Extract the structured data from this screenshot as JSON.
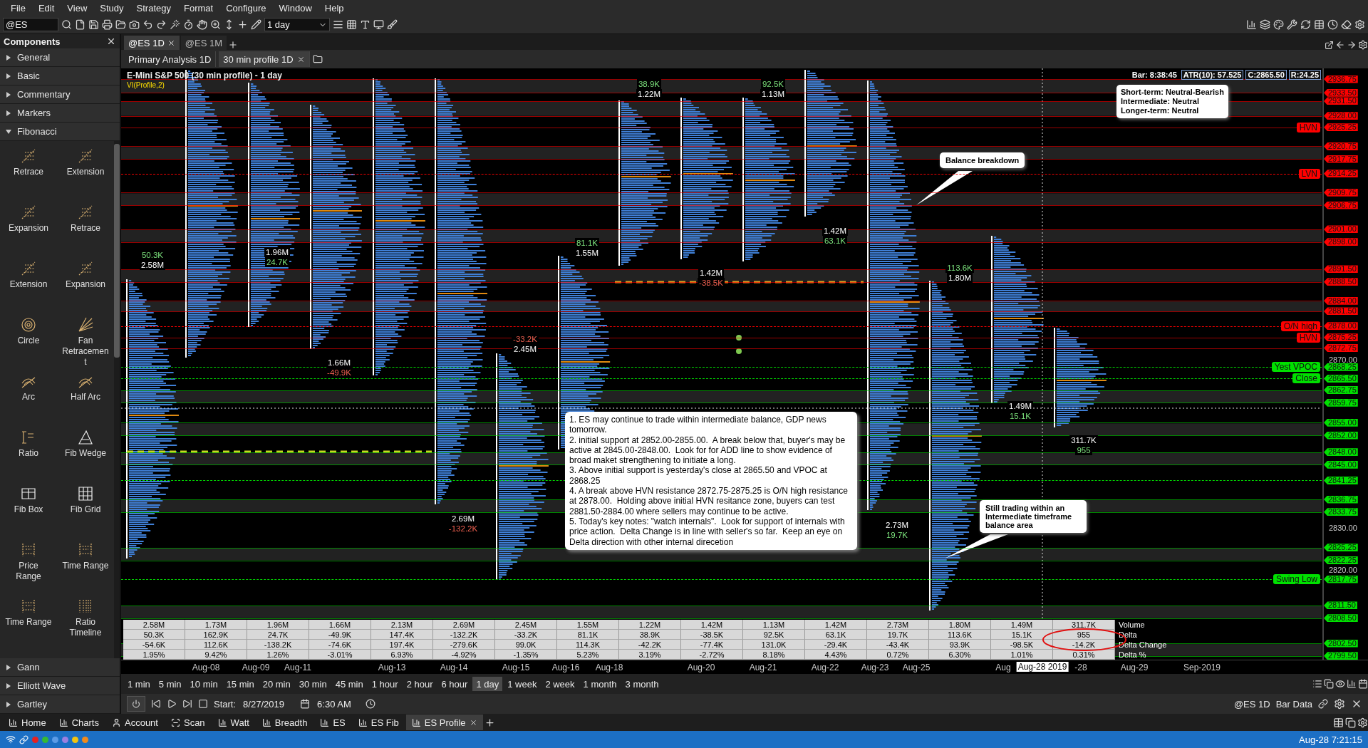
{
  "menu": [
    "File",
    "Edit",
    "View",
    "Study",
    "Strategy",
    "Format",
    "Configure",
    "Window",
    "Help"
  ],
  "toolbar": {
    "symbol": "@ES",
    "interval": "1 day"
  },
  "components": {
    "title": "Components",
    "groups": [
      {
        "label": "General",
        "expanded": false
      },
      {
        "label": "Basic",
        "expanded": false
      },
      {
        "label": "Commentary",
        "expanded": false
      },
      {
        "label": "Markers",
        "expanded": false
      },
      {
        "label": "Fibonacci",
        "expanded": true,
        "tools": [
          "Retrace",
          "Extension",
          "Expansion",
          "Retrace",
          "Extension",
          "Expansion",
          "Circle",
          "Fan Retracement",
          "Arc",
          "Half Arc",
          "Ratio",
          "Fib Wedge",
          "Fib Box",
          "Fib Grid",
          "Price Range",
          "Time Range",
          "Time Range",
          "Ratio Timeline"
        ]
      },
      {
        "label": "Gann",
        "expanded": false
      },
      {
        "label": "Elliott Wave",
        "expanded": false
      },
      {
        "label": "Gartley",
        "expanded": false
      }
    ]
  },
  "chart_tabs": [
    {
      "label": "@ES 1D",
      "selected": true
    },
    {
      "label": "@ES 1M",
      "selected": false
    }
  ],
  "sub_tabs": [
    {
      "label": "Primary Analysis 1D",
      "selected": false
    },
    {
      "label": "30 min profile 1D",
      "selected": true
    }
  ],
  "chart": {
    "title": "E-Mini S&P 500 (30 min profile) - 1 day",
    "study": "VI(Profile,2)",
    "bar_info": "Bar: 8:38:45",
    "info_boxes": [
      "ATR(10): 57.525",
      "C:2865.50",
      "R:24.25"
    ],
    "price_levels": [
      {
        "price": "2936.75",
        "color": "#ff0000",
        "dashed": false
      },
      {
        "price": "2933.50",
        "color": "#ff0000",
        "dashed": false
      },
      {
        "price": "2931.50",
        "color": "#ff0000",
        "dashed": false
      },
      {
        "price": "2928.00",
        "color": "#ff0000",
        "dashed": false
      },
      {
        "price": "2925.25",
        "color": "#ff0000",
        "dashed": false,
        "label": "HVN"
      },
      {
        "price": "2920.75",
        "color": "#ff0000",
        "dashed": false
      },
      {
        "price": "2917.75",
        "color": "#ff0000",
        "dashed": false
      },
      {
        "price": "2914.25",
        "color": "#ff0000",
        "dashed": true,
        "label": "LVN"
      },
      {
        "price": "2909.75",
        "color": "#ff0000",
        "dashed": false
      },
      {
        "price": "2906.75",
        "color": "#ff0000",
        "dashed": false
      },
      {
        "price": "2901.00",
        "color": "#ff0000",
        "dashed": false
      },
      {
        "price": "2898.00",
        "color": "#ff0000",
        "dashed": false
      },
      {
        "price": "2891.50",
        "color": "#ff0000",
        "dashed": false
      },
      {
        "price": "2888.50",
        "color": "#ff0000",
        "dashed": false
      },
      {
        "price": "2884.00",
        "color": "#ff0000",
        "dashed": false
      },
      {
        "price": "2881.50",
        "color": "#ff0000",
        "dashed": false
      },
      {
        "price": "2878.00",
        "color": "#ff0000",
        "dashed": true,
        "label": "O/N high"
      },
      {
        "price": "2875.25",
        "color": "#ff0000",
        "dashed": false,
        "label": "HVN"
      },
      {
        "price": "2872.75",
        "color": "#ff0000",
        "dashed": false
      },
      {
        "price": "2868.25",
        "color": "#00e000",
        "dashed": true,
        "label": "Yest VPOC"
      },
      {
        "price": "2865.50",
        "color": "#00e000",
        "dashed": true,
        "label": "Close"
      },
      {
        "price": "2862.75",
        "color": "#00e000",
        "dashed": false
      },
      {
        "price": "2859.75",
        "color": "#00e000",
        "dashed": false
      },
      {
        "price": "2855.00",
        "color": "#00e000",
        "dashed": false
      },
      {
        "price": "2852.00",
        "color": "#00e000",
        "dashed": false
      },
      {
        "price": "2848.00",
        "color": "#00e000",
        "dashed": false
      },
      {
        "price": "2845.00",
        "color": "#00e000",
        "dashed": false
      },
      {
        "price": "2841.25",
        "color": "#00e000",
        "dashed": true
      },
      {
        "price": "2836.75",
        "color": "#00e000",
        "dashed": false
      },
      {
        "price": "2833.75",
        "color": "#00e000",
        "dashed": false
      },
      {
        "price": "2825.25",
        "color": "#00e000",
        "dashed": false
      },
      {
        "price": "2822.25",
        "color": "#00e000",
        "dashed": false
      },
      {
        "price": "2817.75",
        "color": "#00e000",
        "dashed": true,
        "label": "Swing Low"
      },
      {
        "price": "2811.50",
        "color": "#00e000",
        "dashed": false
      },
      {
        "price": "2808.50",
        "color": "#00e000",
        "dashed": false
      },
      {
        "price": "2802.50",
        "color": "#00e000",
        "dashed": false
      },
      {
        "price": "2799.50",
        "color": "#00e000",
        "dashed": false
      }
    ],
    "axis_labels": [
      "2870.00",
      "2830.00",
      "2820.00"
    ],
    "session_labels": [
      {
        "lines": [
          {
            "text": "50.3K",
            "color": "#7be07b"
          },
          {
            "text": "2.58M",
            "color": "#ffffff"
          }
        ]
      },
      {
        "lines": [
          {
            "text": "1.96M",
            "color": "#ffffff"
          },
          {
            "text": "24.7K",
            "color": "#7be07b"
          }
        ]
      },
      {
        "lines": [
          {
            "text": "1.66M",
            "color": "#ffffff"
          },
          {
            "text": "-49.9K",
            "color": "#f06050"
          }
        ]
      },
      {
        "lines": [
          {
            "text": "-33.2K",
            "color": "#f06050"
          },
          {
            "text": "2.45M",
            "color": "#ffffff"
          }
        ]
      },
      {
        "lines": [
          {
            "text": "2.69M",
            "color": "#ffffff"
          },
          {
            "text": "-132.2K",
            "color": "#f06050"
          }
        ]
      },
      {
        "lines": [
          {
            "text": "81.1K",
            "color": "#7be07b"
          },
          {
            "text": "1.55M",
            "color": "#ffffff"
          }
        ]
      },
      {
        "lines": [
          {
            "text": "38.9K",
            "color": "#7be07b"
          },
          {
            "text": "1.22M",
            "color": "#ffffff"
          }
        ]
      },
      {
        "lines": [
          {
            "text": "1.42M",
            "color": "#ffffff"
          },
          {
            "text": "-38.5K",
            "color": "#f06050"
          }
        ]
      },
      {
        "lines": [
          {
            "text": "92.5K",
            "color": "#7be07b"
          },
          {
            "text": "1.13M",
            "color": "#ffffff"
          }
        ]
      },
      {
        "lines": [
          {
            "text": "1.42M",
            "color": "#ffffff"
          },
          {
            "text": "63.1K",
            "color": "#7be07b"
          }
        ]
      },
      {
        "lines": [
          {
            "text": "2.73M",
            "color": "#ffffff"
          },
          {
            "text": "19.7K",
            "color": "#7be07b"
          }
        ]
      },
      {
        "lines": [
          {
            "text": "113.6K",
            "color": "#7be07b"
          },
          {
            "text": "1.80M",
            "color": "#ffffff"
          }
        ]
      },
      {
        "lines": [
          {
            "text": "1.49M",
            "color": "#ffffff"
          },
          {
            "text": "15.1K",
            "color": "#7be07b"
          }
        ]
      },
      {
        "lines": [
          {
            "text": "311.7K",
            "color": "#ffffff"
          },
          {
            "text": "955",
            "color": "#7be07b"
          }
        ]
      }
    ],
    "outlook": [
      "Short-term: Neutral-Bearish",
      "Intermediate: Neutral",
      "Longer-term: Neutral"
    ],
    "callouts": [
      "Balance breakdown",
      "Still trading within an Intermediate timeframe balance area"
    ],
    "notes": [
      "1. ES may continue to trade within intermediate balance, GDP news tomorrow.",
      "2. initial support at 2852.00-2855.00.  A break below that, buyer's may be active at 2845.00-2848.00.  Look for for ADD line to show evidence of broad maket strengthening to initiate a long.",
      "3. Above initial support is yesterday's close at 2865.50 and VPOC at 2868.25",
      "4. A break above HVN resistance 2872.75-2875.25 is O/N high resistance at 2878.00.  Holding above initial HVN resitance zone, buyers can test 2881.50-2884.00 where sellers may continue to be active.",
      "5. Today's key notes: \"watch internals\".  Look for support of internals with price action.  Delta Change is in line with seller's so far.  Keep an eye on Delta direction with other internal direcetion"
    ],
    "stats_table": {
      "rows": [
        {
          "label": "Volume",
          "values": [
            "2.58M",
            "1.73M",
            "1.96M",
            "1.66M",
            "2.13M",
            "2.69M",
            "2.45M",
            "1.55M",
            "1.22M",
            "1.42M",
            "1.13M",
            "1.42M",
            "2.73M",
            "1.80M",
            "1.49M",
            "311.7K"
          ]
        },
        {
          "label": "Delta",
          "values": [
            "50.3K",
            "162.9K",
            "24.7K",
            "-49.9K",
            "147.4K",
            "-132.2K",
            "-33.2K",
            "81.1K",
            "38.9K",
            "-38.5K",
            "92.5K",
            "63.1K",
            "19.7K",
            "113.6K",
            "15.1K",
            "955"
          ]
        },
        {
          "label": "Delta Change",
          "values": [
            "-54.6K",
            "112.6K",
            "-138.2K",
            "-74.6K",
            "197.4K",
            "-279.6K",
            "99.0K",
            "114.3K",
            "-42.2K",
            "-77.4K",
            "131.0K",
            "-29.4K",
            "-43.4K",
            "93.9K",
            "-98.5K",
            "-14.2K"
          ]
        },
        {
          "label": "Delta %",
          "values": [
            "1.95%",
            "9.42%",
            "1.26%",
            "-3.01%",
            "6.93%",
            "-4.92%",
            "-1.35%",
            "5.23%",
            "3.19%",
            "-2.72%",
            "8.18%",
            "4.43%",
            "0.72%",
            "6.30%",
            "1.01%",
            "0.31%"
          ]
        }
      ]
    },
    "x_labels": [
      "Aug-08",
      "Aug-09",
      "Aug-11",
      "Aug-13",
      "Aug-14",
      "Aug-15",
      "Aug-16",
      "Aug-18",
      "Aug-20",
      "Aug-21",
      "Aug-22",
      "Aug-23",
      "Aug-25",
      "Aug",
      "-28",
      "Aug-29",
      "Sep-2019"
    ],
    "crosshair_date": "Aug-28 2019"
  },
  "timeframes": [
    {
      "label": "1 min",
      "selected": false
    },
    {
      "label": "5 min",
      "selected": false
    },
    {
      "label": "10 min",
      "selected": false
    },
    {
      "label": "15 min",
      "selected": false
    },
    {
      "label": "20 min",
      "selected": false
    },
    {
      "label": "30 min",
      "selected": false
    },
    {
      "label": "45 min",
      "selected": false
    },
    {
      "label": "1 hour",
      "selected": false
    },
    {
      "label": "2 hour",
      "selected": false
    },
    {
      "label": "6 hour",
      "selected": false
    },
    {
      "label": "1 day",
      "selected": true
    },
    {
      "label": "1 week",
      "selected": false
    },
    {
      "label": "2 week",
      "selected": false
    },
    {
      "label": "1 month",
      "selected": false
    },
    {
      "label": "3 month",
      "selected": false
    }
  ],
  "playback": {
    "start_label": "Start:",
    "date": "8/27/2019",
    "time": "6:30 AM",
    "symbol": "@ES 1D",
    "data": "Bar Data"
  },
  "workspace_tabs": [
    {
      "label": "Home",
      "selected": false
    },
    {
      "label": "Charts",
      "selected": false
    },
    {
      "label": "Account",
      "selected": false
    },
    {
      "label": "Scan",
      "selected": false
    },
    {
      "label": "Watt",
      "selected": false
    },
    {
      "label": "Breadth",
      "selected": false
    },
    {
      "label": "ES",
      "selected": false
    },
    {
      "label": "ES Fib",
      "selected": false
    },
    {
      "label": "ES Profile",
      "selected": true
    }
  ],
  "status": {
    "time": "Aug-28 7:21:15",
    "dots": [
      {
        "color": "#e52121"
      },
      {
        "color": "#35b935"
      },
      {
        "color": "#5b9be6"
      },
      {
        "color": "#9b7fe0"
      },
      {
        "color": "#f2c311"
      },
      {
        "color": "#f08a1c"
      }
    ]
  }
}
